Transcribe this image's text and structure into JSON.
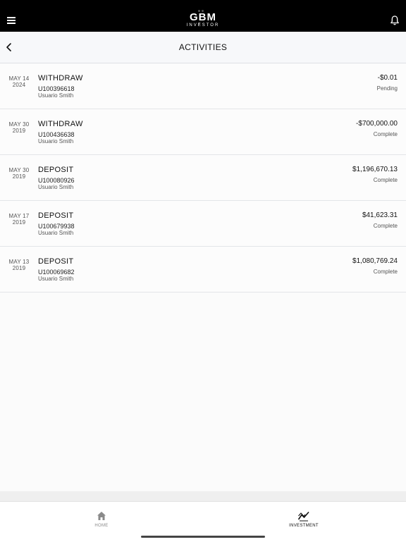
{
  "header": {
    "logo_main": "GBM",
    "logo_sub": "INVESTOR",
    "icons": {
      "menu": "hamburger-menu-icon",
      "notifications": "bell-icon"
    }
  },
  "subheader": {
    "title": "ACTIVITIES",
    "back_icon": "chevron-left-icon"
  },
  "activities": [
    {
      "month_day": "MAY 14",
      "year": "2024",
      "type": "WITHDRAW",
      "account": "U100396618",
      "owner": "Usuario Smith",
      "amount": "-$0.01",
      "status": "Pending"
    },
    {
      "month_day": "MAY 30",
      "year": "2019",
      "type": "WITHDRAW",
      "account": "U100436638",
      "owner": "Usuario Smith",
      "amount": "-$700,000.00",
      "status": "Complete"
    },
    {
      "month_day": "MAY 30",
      "year": "2019",
      "type": "DEPOSIT",
      "account": "U100080926",
      "owner": "Usuario Smith",
      "amount": "$1,196,670.13",
      "status": "Complete"
    },
    {
      "month_day": "MAY 17",
      "year": "2019",
      "type": "DEPOSIT",
      "account": "U100679938",
      "owner": "Usuario Smith",
      "amount": "$41,623.31",
      "status": "Complete"
    },
    {
      "month_day": "MAY 13",
      "year": "2019",
      "type": "DEPOSIT",
      "account": "U100069682",
      "owner": "Usuario Smith",
      "amount": "$1,080,769.24",
      "status": "Complete"
    }
  ],
  "tabbar": {
    "home_label": "HOME",
    "investment_label": "INVESTMENT",
    "active_tab": "INVESTMENT",
    "icons": {
      "home": "house-icon",
      "investment": "line-chart-icon"
    }
  },
  "colors": {
    "topbar": "#000000",
    "background": "#fbfbfb",
    "text": "#111111",
    "muted": "#555555"
  }
}
